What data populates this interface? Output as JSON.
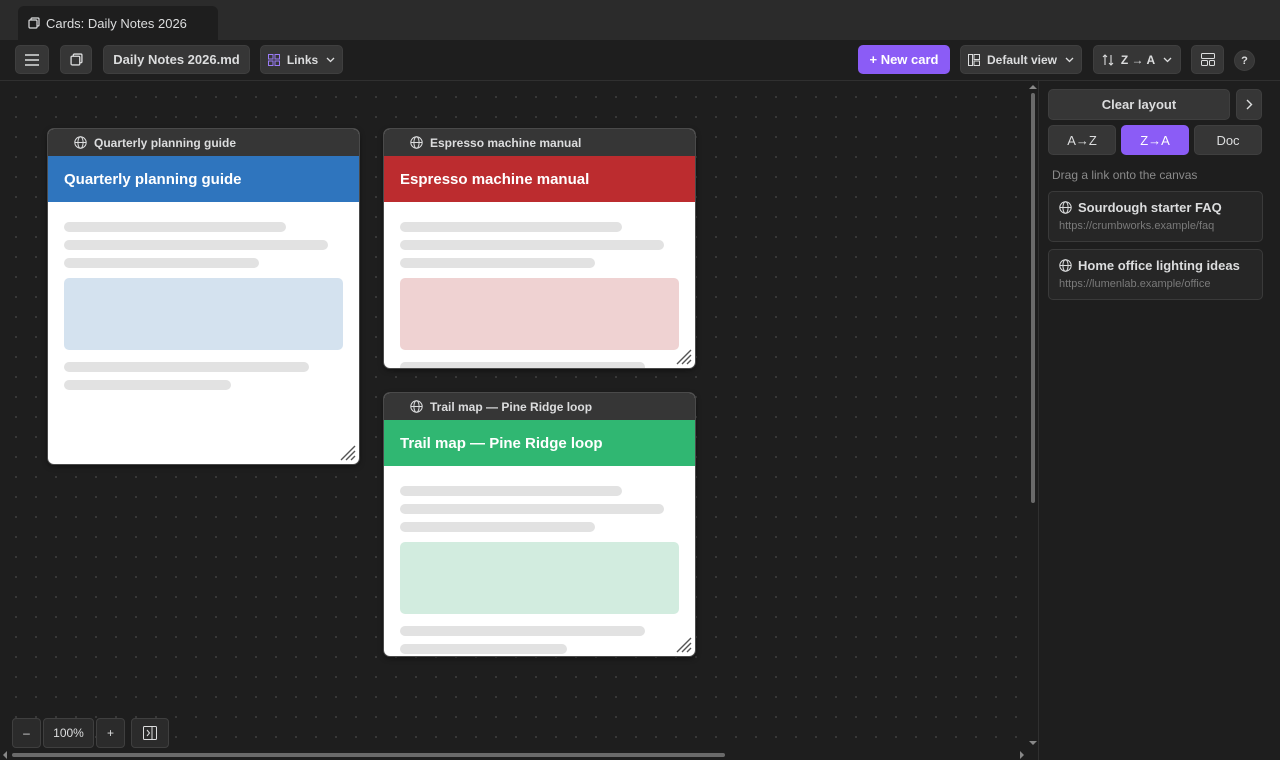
{
  "tab": {
    "title": "Cards: Daily Notes 2026"
  },
  "toolbar": {
    "file_label": "Daily Notes 2026.md",
    "links_label": "Links",
    "new_card_label": "+ New card",
    "view_label": "Default view",
    "sort_label": "Z → A",
    "help_label": "?"
  },
  "cards": [
    {
      "header": "Quarterly planning guide",
      "title": "Quarterly planning guide",
      "accent": "#2f75be"
    },
    {
      "header": "Espresso machine manual",
      "title": "Espresso machine manual",
      "accent": "#bc2c2f"
    },
    {
      "header": "Trail map — Pine Ridge loop",
      "title": "Trail map — Pine Ridge loop",
      "accent": "#30b772"
    }
  ],
  "zoom": {
    "minus": "–",
    "level": "100%",
    "plus": "+"
  },
  "panel": {
    "clear_layout": "Clear layout",
    "sort_options": [
      "A→Z",
      "Z→A",
      "Doc"
    ],
    "active_sort": "Z→A",
    "hint": "Drag a link onto the canvas",
    "links": [
      {
        "title": "Sourdough starter FAQ",
        "url": "https://crumbworks.example/faq"
      },
      {
        "title": "Home office lighting ideas",
        "url": "https://lumenlab.example/office"
      }
    ]
  },
  "colors": {
    "accent": "#8b5cf6"
  }
}
